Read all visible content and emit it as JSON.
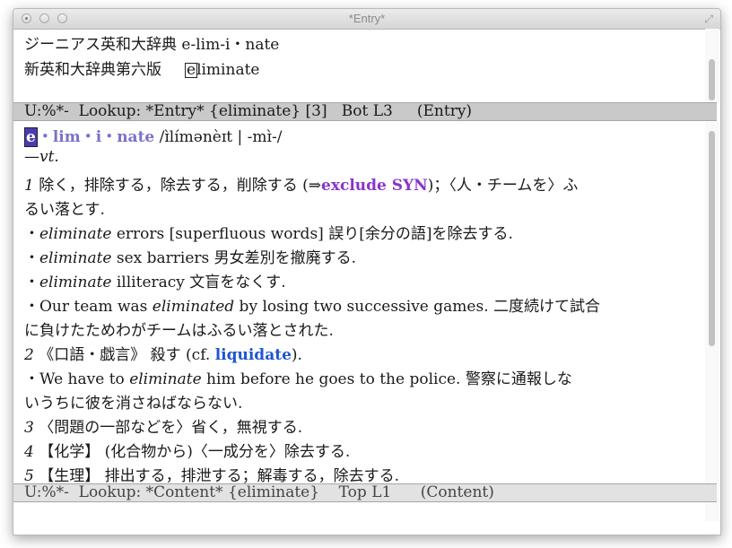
{
  "window": {
    "title": "*Entry*"
  },
  "entry_pane": {
    "lines": [
      "ジーニアス英和大辞典 e-lim-i・nate",
      "新英和大辞典第六版",
      "liminate"
    ],
    "cursor_char": "e"
  },
  "modeline_top": "U:%*-  Lookup: *Entry* {eliminate} [3]   Bot L3     (Entry)",
  "content": {
    "head_cursor": "e",
    "head_rest": "・lim・i・nate",
    "pron": " /ɪ̀límənèɪt | -mɪ̀-/",
    "pos": "—vt.",
    "s1_num": "1",
    "s1_text": " 除く，排除する，除去する，削除する (",
    "s1_arrow": "⇒",
    "s1_xref": "exclude SYN",
    "s1_tail": ")；〈人・チームを〉ふ",
    "s1_cont": "るい落とす.",
    "ex1_pre": "・",
    "ex1_word": "eliminate",
    "ex1_rest": " errors [superfluous words] 誤り[余分の語]を除去する.",
    "ex2_word": "eliminate",
    "ex2_rest": " sex barriers 男女差別を撤廃する.",
    "ex3_word": "eliminate",
    "ex3_rest": " illiteracy 文盲をなくす.",
    "ex4_pre": "・Our team was ",
    "ex4_word": "eliminated",
    "ex4_rest": " by losing two successive games. 二度続けて試合",
    "ex4_cont": "に負けたためわがチームはふるい落とされた.",
    "s2_num": "2",
    "s2_text": " 《口語・戯言》 殺す (cf. ",
    "s2_link": "liquidate",
    "s2_tail": ").",
    "ex5_pre": "・We have to ",
    "ex5_word": "eliminate",
    "ex5_rest": " him before he goes to the police. 警察に通報しな",
    "ex5_cont": "いうちに彼を消さねばならない.",
    "s3_num": "3",
    "s3_text": " 〈問題の一部などを〉省く，無視する.",
    "s4_num": "4",
    "s4_text": " 【化学】 (化合物から)〈一成分を〉除去する.",
    "s5_num": "5",
    "s5_text": " 【生理】 排出する，排泄する；解毒する，除去する."
  },
  "modeline_bottom": "U:%*-  Lookup: *Content* {eliminate}    Top L1      (Content)"
}
